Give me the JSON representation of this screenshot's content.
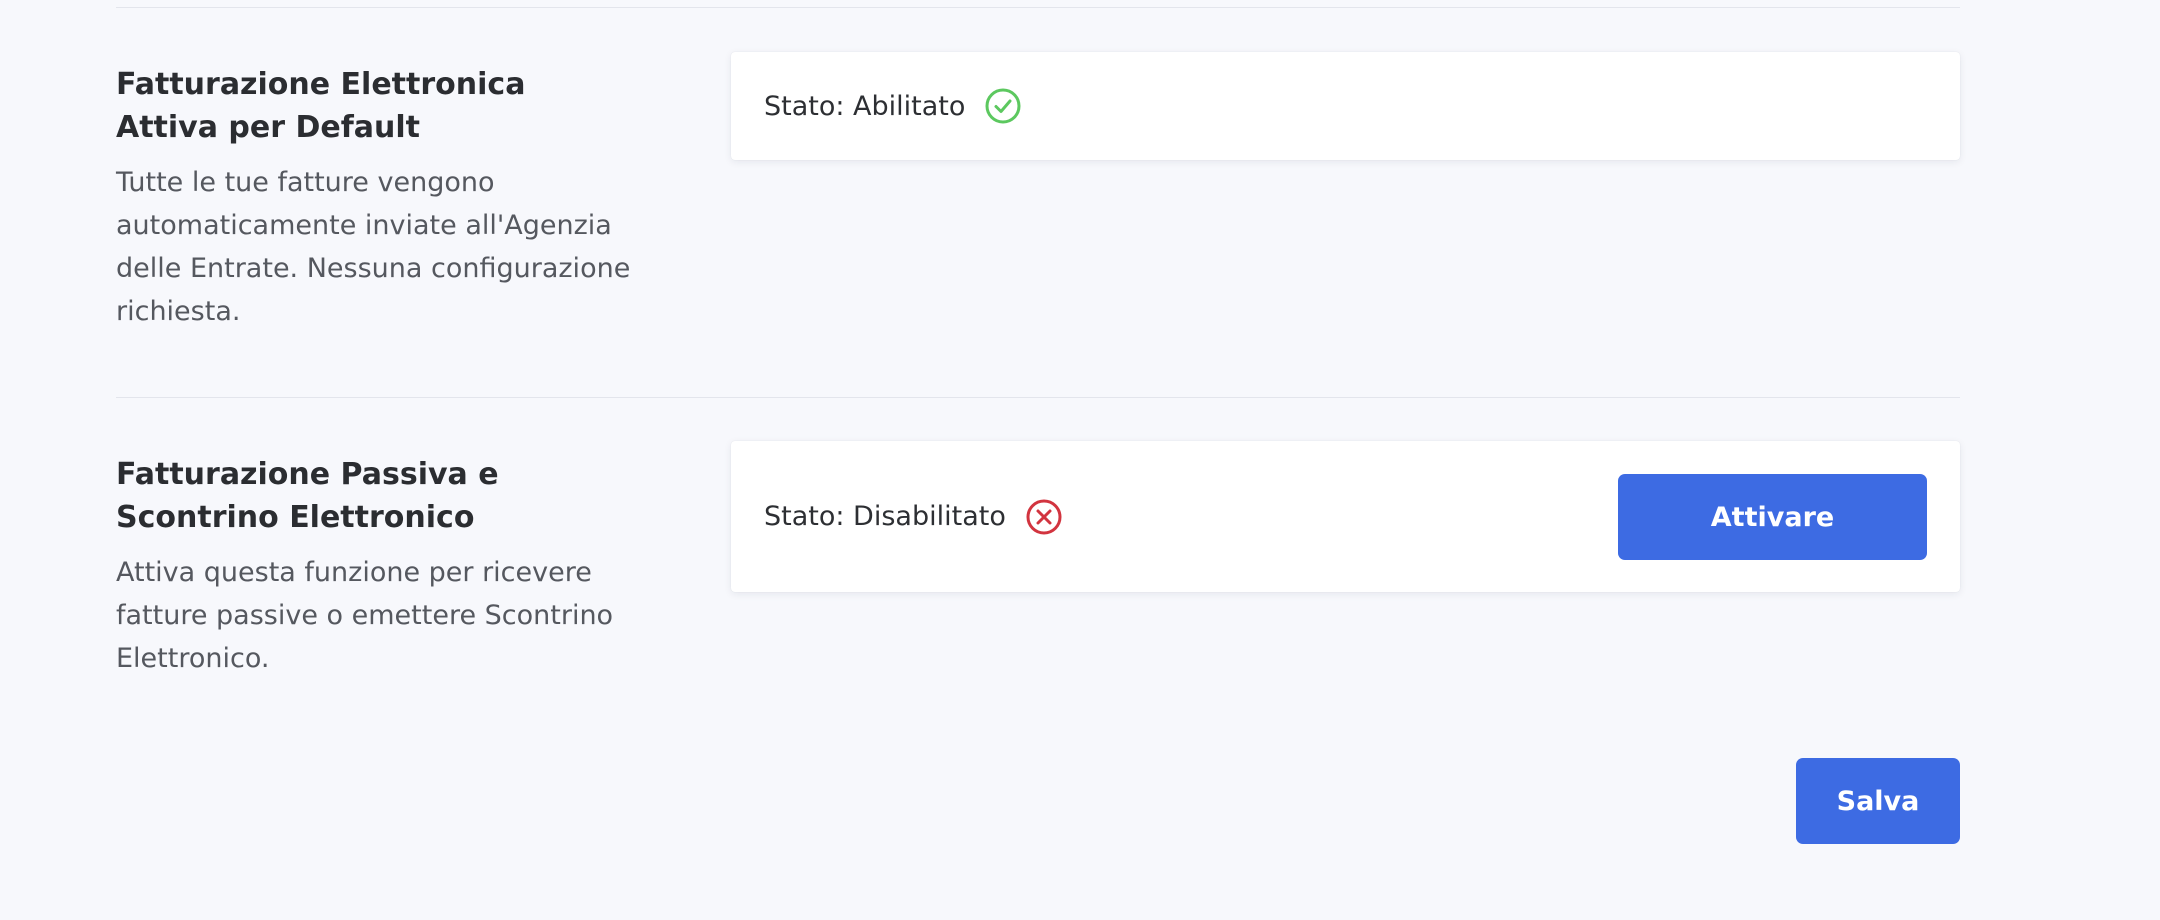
{
  "sections": [
    {
      "title": "Fatturazione Elettronica Attiva per Default",
      "description": "Tutte le tue fatture vengono automaticamente inviate all'Agenzia delle Entrate. Nessuna configurazione richiesta.",
      "status_label": "Stato: Abilitato",
      "status_icon": "check-circle-icon",
      "status_color": "#5cc85f"
    },
    {
      "title": "Fatturazione Passiva e Scontrino Elettronico",
      "description": "Attiva questa funzione per ricevere fatture passive o emettere Scontrino Elettronico.",
      "status_label": "Stato: Disabilitato",
      "status_icon": "x-circle-icon",
      "status_color": "#d2343f",
      "action_label": "Attivare"
    }
  ],
  "footer": {
    "save_label": "Salva"
  },
  "colors": {
    "accent": "#3d6be3",
    "background": "#f7f8fc"
  }
}
